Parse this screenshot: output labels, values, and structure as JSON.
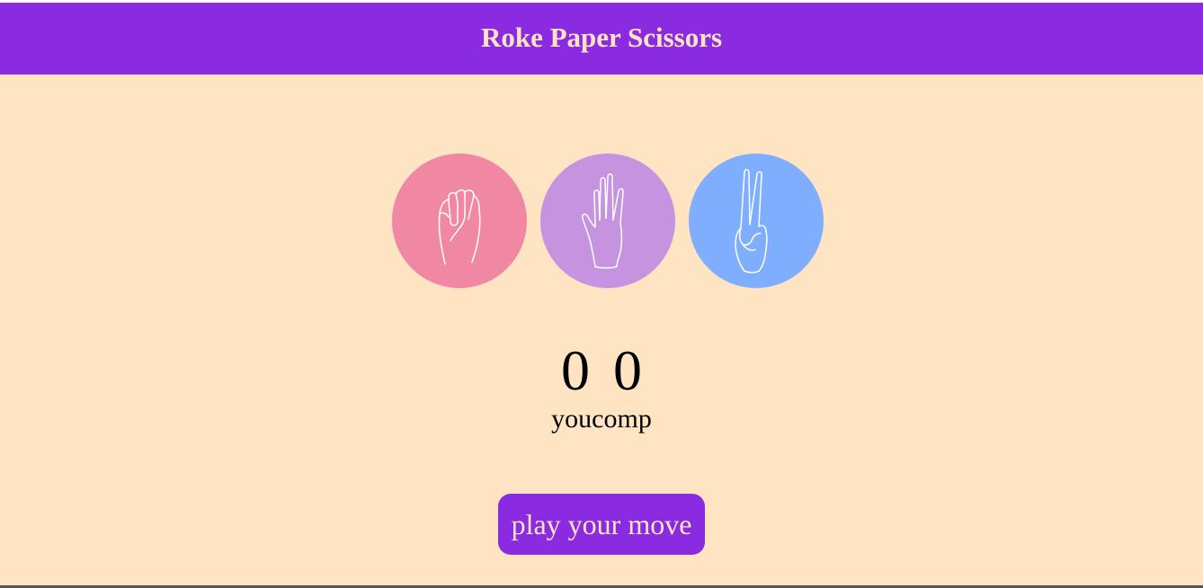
{
  "app": {
    "title": "Roke Paper Scissors"
  },
  "choices": [
    {
      "name": "rock",
      "color": "#f088a4",
      "icon": "fist-icon"
    },
    {
      "name": "paper",
      "color": "#c593e0",
      "icon": "open-hand-icon"
    },
    {
      "name": "scissors",
      "color": "#80aeff",
      "icon": "peace-hand-icon"
    }
  ],
  "score": {
    "user_score": "0",
    "comp_score": "0",
    "user_label": "you",
    "comp_label": "comp"
  },
  "message": {
    "text": "play your move",
    "color": "#8a2be2"
  },
  "colors": {
    "background": "#ffe4c4",
    "accent": "#8a2be2",
    "accent_text": "#ffe4c4"
  }
}
